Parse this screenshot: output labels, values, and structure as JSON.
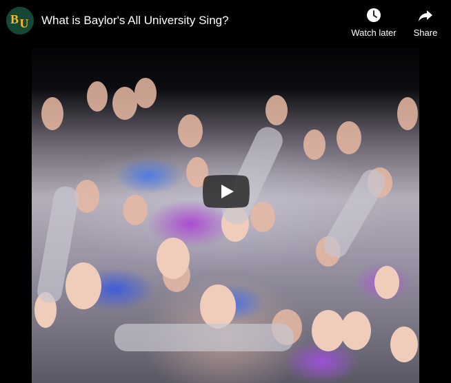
{
  "video": {
    "title": "What is Baylor's All University Sing?",
    "channel_logo_icon": "baylor-bu-logo-icon"
  },
  "actions": {
    "watch_later": {
      "label": "Watch later",
      "icon": "clock-icon"
    },
    "share": {
      "label": "Share",
      "icon": "share-arrow-icon"
    }
  },
  "player": {
    "play_icon": "play-icon"
  },
  "colors": {
    "baylor_green": "#154734",
    "baylor_gold": "#FFB81C",
    "play_button_bg": "#212121",
    "overlay_text": "#FFFFFF"
  }
}
